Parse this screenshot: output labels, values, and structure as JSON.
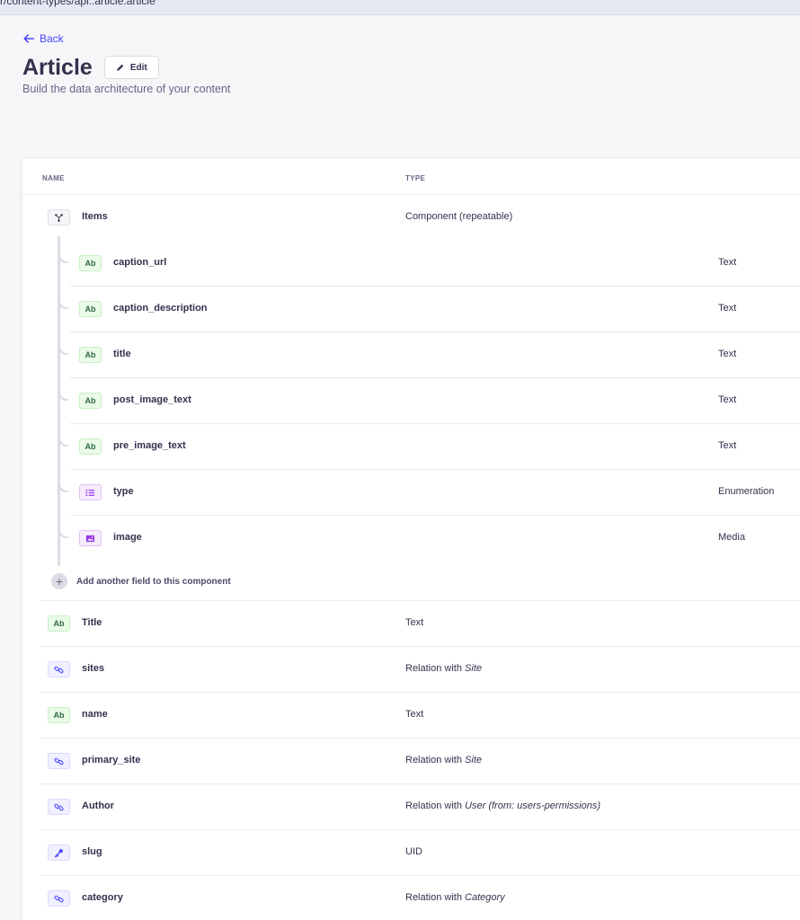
{
  "browser": {
    "url_fragment": "r/content-types/api::article.article"
  },
  "nav": {
    "back_label": "Back"
  },
  "header": {
    "title": "Article",
    "edit_label": "Edit",
    "subtitle": "Build the data architecture of your content"
  },
  "table": {
    "col_name": "NAME",
    "col_type": "TYPE"
  },
  "component": {
    "name": "Items",
    "type": "Component (repeatable)",
    "fields": [
      {
        "name": "caption_url",
        "type": "Text",
        "icon": "text-icon"
      },
      {
        "name": "caption_description",
        "type": "Text",
        "icon": "text-icon"
      },
      {
        "name": "title",
        "type": "Text",
        "icon": "text-icon"
      },
      {
        "name": "post_image_text",
        "type": "Text",
        "icon": "text-icon"
      },
      {
        "name": "pre_image_text",
        "type": "Text",
        "icon": "text-icon"
      },
      {
        "name": "type",
        "type": "Enumeration",
        "icon": "enumeration-icon"
      },
      {
        "name": "image",
        "type": "Media",
        "icon": "media-icon"
      }
    ],
    "add_field_label": "Add another field to this component"
  },
  "fields": [
    {
      "name": "Title",
      "type": "Text",
      "icon": "text-icon"
    },
    {
      "name": "sites",
      "type_prefix": "Relation with ",
      "type_target": "Site",
      "icon": "relation-icon"
    },
    {
      "name": "name",
      "type": "Text",
      "icon": "text-icon"
    },
    {
      "name": "primary_site",
      "type_prefix": "Relation with ",
      "type_target": "Site",
      "icon": "relation-icon"
    },
    {
      "name": "Author",
      "type_prefix": "Relation with ",
      "type_target": "User (from: users-permissions)",
      "icon": "relation-icon"
    },
    {
      "name": "slug",
      "type": "UID",
      "icon": "uid-icon"
    },
    {
      "name": "category",
      "type_prefix": "Relation with ",
      "type_target": "Category",
      "icon": "relation-icon"
    }
  ],
  "icon_text": "Ab",
  "colors": {
    "accent": "#4945ff",
    "text_badge": "#eafbe7",
    "enum_badge": "#f6ecfc"
  }
}
